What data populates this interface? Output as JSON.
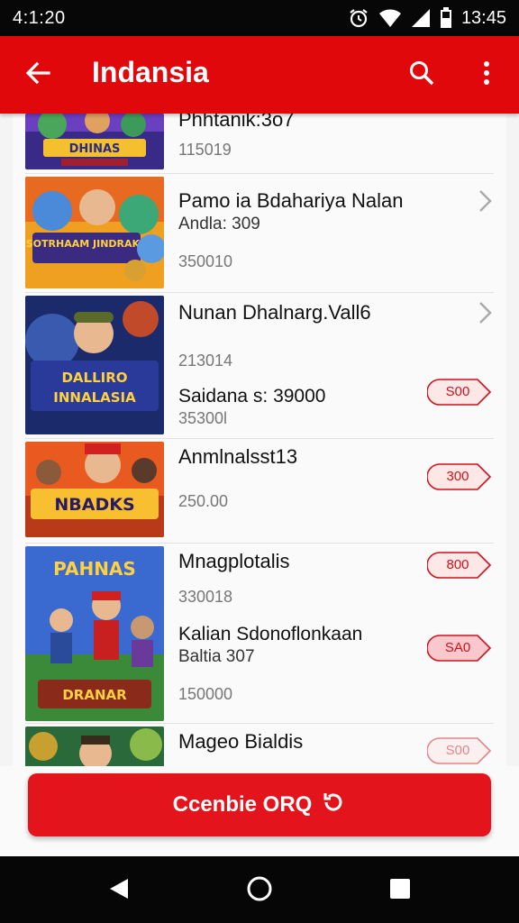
{
  "status_bar": {
    "time": "4:1:20",
    "clock": "13:45",
    "icons": [
      "alarm-icon",
      "wifi-icon",
      "signal-icon",
      "battery-icon"
    ]
  },
  "app_bar": {
    "title": "Indansia",
    "icons": [
      "arrow-back-icon",
      "search-icon",
      "more-vertical-icon"
    ]
  },
  "items": [
    {
      "title": "Phhtanik:3o7",
      "subtitle": "",
      "number": "115019",
      "extra": "",
      "extra_number": "",
      "action": ""
    },
    {
      "title": "Pamo ia Bdahariya Nalan",
      "subtitle": "Andla: 309",
      "number": "350010",
      "extra": "",
      "extra_number": "",
      "action": "chevron"
    },
    {
      "title": "Nunan Dhalnarg.Vall6",
      "subtitle": "",
      "number": "213014",
      "extra": "Saidana s: 39000",
      "extra_number": "35300l",
      "action": "chevron",
      "pill": "S00"
    },
    {
      "title": "Anmlnalsst13",
      "subtitle": "",
      "number": "250.00",
      "extra": "",
      "extra_number": "",
      "action": "pill",
      "pill": "300"
    },
    {
      "title": "Mnagplotalis",
      "subtitle": "",
      "number": "330018",
      "extra": "Kalian Sdonoflonkaan",
      "extra_sub": "Baltia 307",
      "extra_number": "150000",
      "action": "pill",
      "pill": "800",
      "pill2": "SA0"
    },
    {
      "title": "Mageo Bialdis",
      "subtitle": "",
      "number": "",
      "extra": "",
      "extra_number": "",
      "action": "pill",
      "pill": "S00"
    }
  ],
  "thumb_captions": [
    "DHINAS",
    "SOTRHAAM JINDRAKII",
    "DALLIRO INNALASIA",
    "NBADKS",
    "PAHNAS",
    "DRANAR"
  ],
  "cta": {
    "label": "Ccenbie ORQ",
    "icon": "refresh-icon"
  },
  "nav_bar": {
    "icons": [
      "back-triangle-icon",
      "home-circle-icon",
      "recents-square-icon"
    ]
  },
  "colors": {
    "primary": "#e0080b",
    "cta": "#e4141c",
    "pill_border": "#d0111a"
  }
}
